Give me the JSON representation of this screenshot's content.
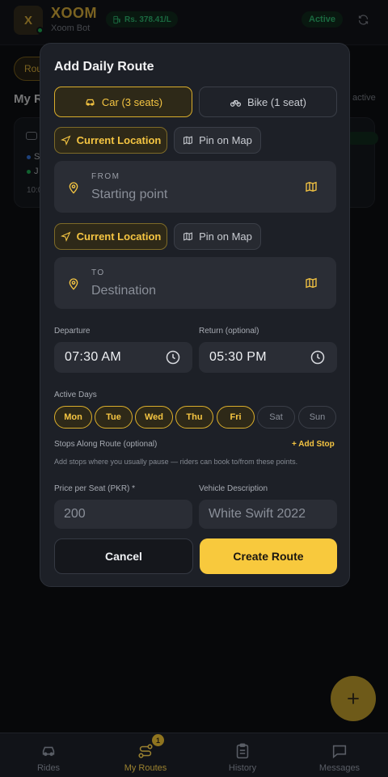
{
  "header": {
    "logo_letter": "X",
    "app_name": "XOOM",
    "bot_name": "Xoom Bot",
    "fuel_price": "Rs. 378.41/L",
    "status": "Active"
  },
  "background": {
    "chip_label": "Rou",
    "section_title": "My R",
    "active_label": "active",
    "card_line1": "S",
    "card_line2": "J",
    "card_time": "10:0"
  },
  "modal": {
    "title": "Add Daily Route",
    "vehicle_options": [
      "Car (3 seats)",
      "Bike (1 seat)"
    ],
    "selected_vehicle": "Car (3 seats)",
    "current_location_label": "Current Location",
    "pin_on_map_label": "Pin on Map",
    "from": {
      "label": "FROM",
      "placeholder": "Starting point"
    },
    "to": {
      "label": "TO",
      "placeholder": "Destination"
    },
    "departure": {
      "label": "Departure",
      "value": "07:30 AM"
    },
    "return": {
      "label": "Return (optional)",
      "value": "05:30 PM"
    },
    "active_days_label": "Active Days",
    "days": [
      {
        "label": "Mon",
        "on": true
      },
      {
        "label": "Tue",
        "on": true
      },
      {
        "label": "Wed",
        "on": true
      },
      {
        "label": "Thu",
        "on": true
      },
      {
        "label": "Fri",
        "on": true
      },
      {
        "label": "Sat",
        "on": false
      },
      {
        "label": "Sun",
        "on": false
      }
    ],
    "stops_label": "Stops Along Route (optional)",
    "add_stop_label": "+ Add Stop",
    "stops_hint": "Add stops where you usually pause — riders can book to/from these points.",
    "price": {
      "label": "Price per Seat (PKR) *",
      "placeholder": "200"
    },
    "vehicle_desc": {
      "label": "Vehicle Description",
      "placeholder": "White Swift 2022"
    },
    "cancel_label": "Cancel",
    "create_label": "Create Route"
  },
  "nav": {
    "items": [
      {
        "label": "Rides",
        "icon": "car-icon"
      },
      {
        "label": "My Routes",
        "icon": "route-icon"
      },
      {
        "label": "History",
        "icon": "clipboard-icon"
      },
      {
        "label": "Messages",
        "icon": "message-icon"
      }
    ],
    "active": "My Routes",
    "routes_badge": "1"
  },
  "colors": {
    "accent": "#f5c542",
    "success": "#35d07f",
    "surface": "#1d2027"
  }
}
